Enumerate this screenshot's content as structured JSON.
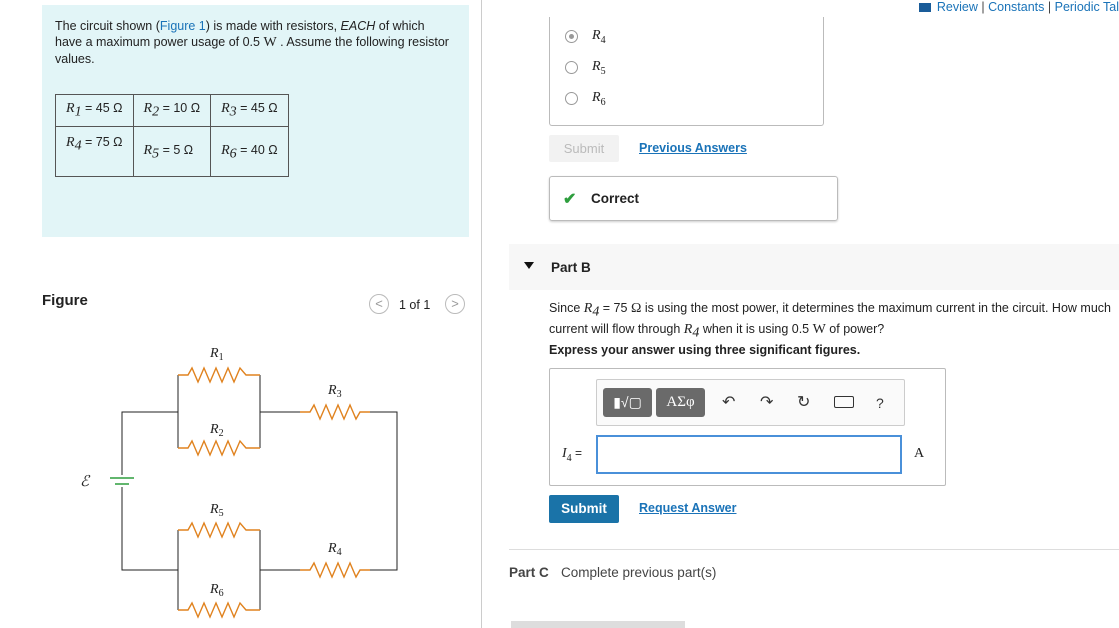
{
  "header": {
    "review_link": "Review",
    "constants_link": "Constants",
    "periodic_link": "Periodic Tal",
    "separator": "|"
  },
  "problem": {
    "intro_prefix": "The circuit shown (",
    "figure_link": "Figure 1",
    "intro_mid": ") is made with resistors, ",
    "intro_each": "EACH",
    "intro_rest": " of which have a maximum power usage of 0.5 ",
    "intro_unit": "W",
    "intro_tail": " . Assume the following resistor values.",
    "resistors": [
      [
        {
          "sym": "R",
          "sub": "1",
          "val": " = 45 Ω"
        },
        {
          "sym": "R",
          "sub": "2",
          "val": " = 10 Ω"
        },
        {
          "sym": "R",
          "sub": "3",
          "val": " = 45 Ω"
        }
      ],
      [
        {
          "sym": "R",
          "sub": "4",
          "val": " = 75 Ω"
        },
        {
          "sym": "R",
          "sub": "5",
          "val": " = 5 Ω"
        },
        {
          "sym": "R",
          "sub": "6",
          "val": " = 40 Ω"
        }
      ]
    ]
  },
  "figure": {
    "label": "Figure",
    "counter": "1 of 1",
    "prev": "<",
    "next": ">",
    "emf_label": "ℰ",
    "resistor_labels": [
      "R1",
      "R2",
      "R3",
      "R5",
      "R4",
      "R6"
    ]
  },
  "part_a": {
    "choices": [
      {
        "sym": "R",
        "sub": "4",
        "selected": true
      },
      {
        "sym": "R",
        "sub": "5",
        "selected": false
      },
      {
        "sym": "R",
        "sub": "6",
        "selected": false
      }
    ],
    "submit_label": "Submit",
    "previous_answers": "Previous Answers",
    "result_icon": "check-icon",
    "result_text": "Correct",
    "result_color": "#2e9e3e"
  },
  "part_b": {
    "title": "Part B",
    "q1": "Since ",
    "q_sym": "R",
    "q_sub": "4",
    "q2": " = 75 ",
    "q_ohm": "Ω",
    "q3": " is using the most power, it determines the maximum current in the circuit.  How much current will flow through ",
    "q4": " when it is using 0.5 ",
    "q_w": "W",
    "q5": " of power?",
    "instruction": "Express your answer using three significant figures.",
    "toolbar": {
      "template": "▮√▢",
      "greek": "ΑΣφ",
      "undo": "↶",
      "redo": "↷",
      "reset": "↻",
      "help": "?"
    },
    "input_sym": "I",
    "input_sub": "4",
    "input_eq": " = ",
    "input_value": "",
    "unit": "A",
    "submit_label": "Submit",
    "request_answer": "Request Answer",
    "accent": "#1a73a8"
  },
  "part_c": {
    "title": "Part C",
    "text": "Complete previous part(s)"
  }
}
